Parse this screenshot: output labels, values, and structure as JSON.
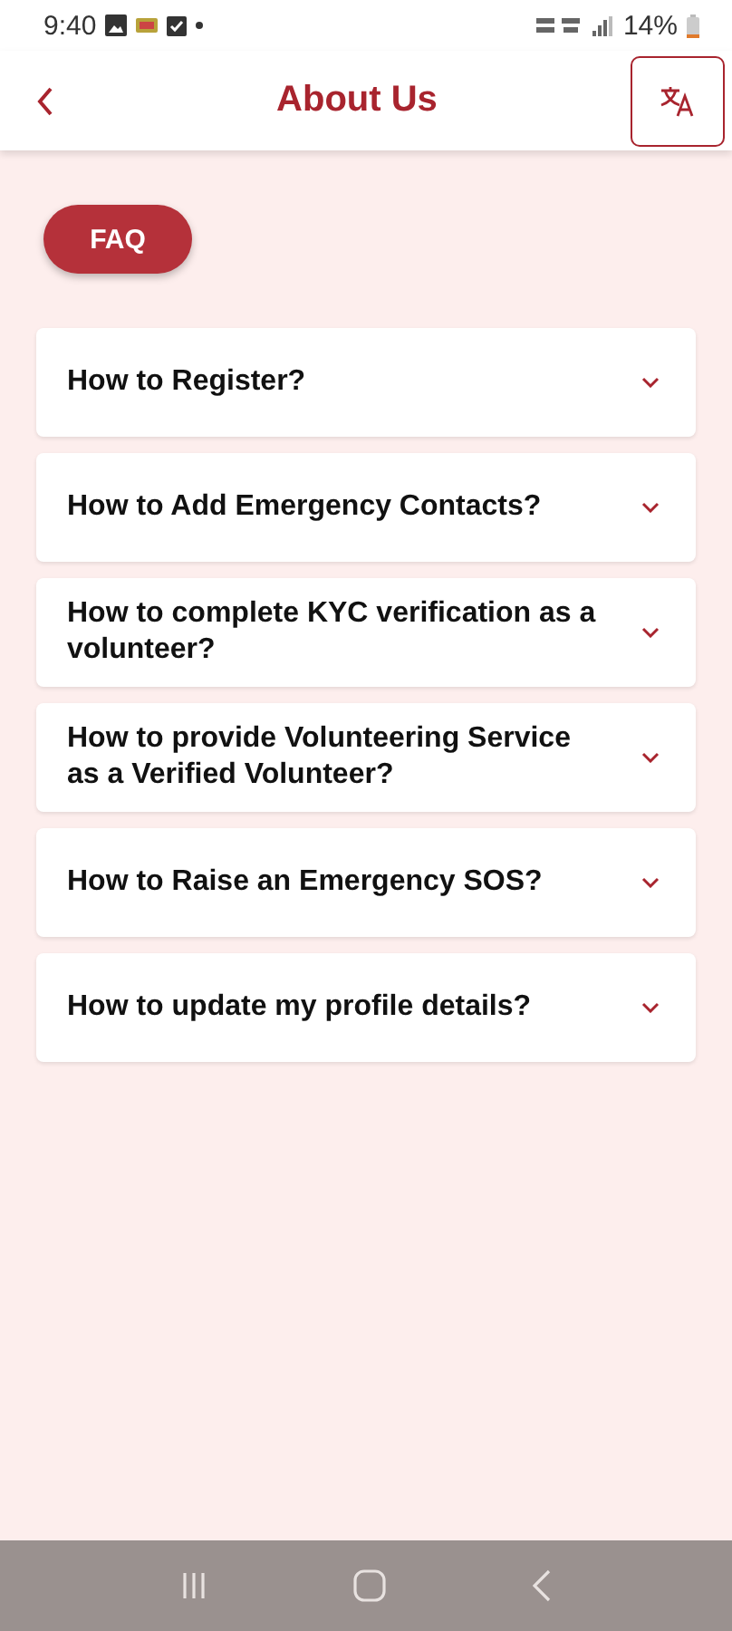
{
  "status_bar": {
    "time": "9:40",
    "battery": "14%"
  },
  "header": {
    "title": "About Us"
  },
  "faq_button": "FAQ",
  "faq_items": [
    {
      "question": "How to Register?",
      "expanded": false
    },
    {
      "question": "How to Add Emergency Contacts?",
      "expanded": false
    },
    {
      "question": "How to complete KYC verification as a volunteer?",
      "expanded": false
    },
    {
      "question": "How to provide Volunteering Service as a Verified Volunteer?",
      "expanded": false
    },
    {
      "question": "How to Raise an Emergency SOS?",
      "expanded": false
    },
    {
      "question": "How to update my profile details?",
      "expanded": false
    }
  ]
}
